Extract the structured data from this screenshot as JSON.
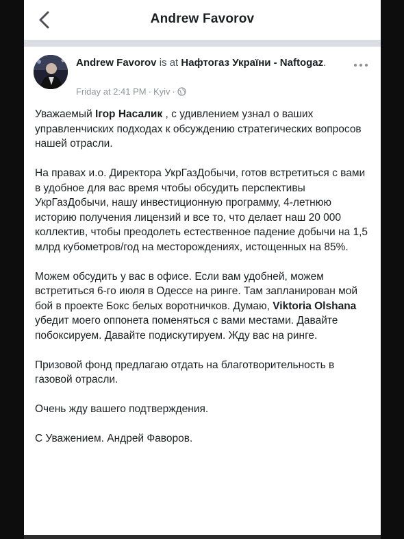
{
  "nav": {
    "title": "Andrew Favorov"
  },
  "post": {
    "author": "Andrew Favorov",
    "is_at": "is at",
    "place": "Нафтогаз України - Naftogaz",
    "place_end": ".",
    "timestamp": "Friday at 2:41 PM",
    "location": "Kyiv",
    "dot": "·",
    "icons": {
      "back": "chevron-left-icon",
      "more": "more-options-icon",
      "audience": "globe-icon"
    },
    "paragraphs": [
      {
        "pre": "Уважаемый ",
        "mention": "Ігор Насалик",
        "post": " , с удивлением узнал о ваших управленчиских подходах к обсуждению стратегических вопросов нашей отрасли."
      },
      {
        "text": "На правах и.о. Директора УкрГазДобычи, готов встретиться с вами в удобное для вас время чтобы обсудить перспективы УкрГазДобычи, нашу инвестиционную программу, 4-летнюю историю получения лицензий и все то, что делает наш 20 000 коллектив, чтобы преодолеть естественное падение добычи на 1,5 млрд кубометров/год на месторождениях, истощенных на 85%."
      },
      {
        "pre": "Можем обсудить у вас в офисе. Если вам удобней, можем встретиться 6-го июля в Одессе на ринге. Там запланирован мой бой в проекте Бокс белых воротничков. Думаю, ",
        "mention": "Viktoria Olshana",
        "post": " убедит моего оппонета поменяться с вами местами. Давайте побоксируем. Давайте подискутируем. Жду вас на ринге."
      },
      {
        "text": "Призовой фонд предлагаю отдать на благотворительность в газовой отрасли."
      },
      {
        "text": "Очень жду вашего подтверждения."
      },
      {
        "text": "С Уважением. Андрей Фаворов."
      }
    ]
  }
}
